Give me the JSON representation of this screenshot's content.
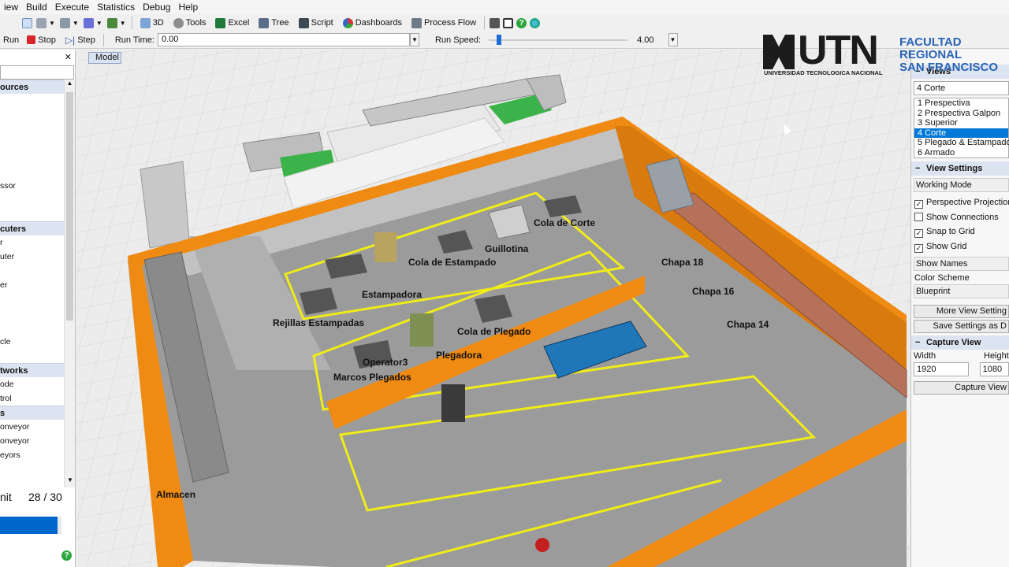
{
  "menu": [
    "iew",
    "Build",
    "Execute",
    "Statistics",
    "Debug",
    "Help"
  ],
  "toolbar": {
    "btn_3d": "3D",
    "btn_tools": "Tools",
    "btn_excel": "Excel",
    "btn_tree": "Tree",
    "btn_script": "Script",
    "btn_dashboards": "Dashboards",
    "btn_processflow": "Process Flow"
  },
  "runbar": {
    "run": "Run",
    "stop": "Stop",
    "step": "Step",
    "run_time_label": "Run Time:",
    "run_time_value": "0.00",
    "run_speed_label": "Run Speed:",
    "run_speed_value": "4.00",
    "run_speed_fraction": 0.08
  },
  "left_panel": {
    "close": "✕",
    "sections": [
      {
        "title": "ources",
        "items": [
          "",
          "",
          "",
          "",
          "",
          "",
          "ssor",
          "",
          ""
        ]
      },
      {
        "title": "cuters",
        "items": [
          "r",
          "uter",
          "",
          "er",
          "",
          "",
          "",
          "cle",
          ""
        ]
      },
      {
        "title": "tworks",
        "items": [
          "ode",
          "trol"
        ]
      },
      {
        "title": "s",
        "items": [
          "onveyor",
          "onveyor",
          "eyors"
        ]
      }
    ],
    "limit_label": "nit",
    "limit_value": "28 / 30",
    "limit_fraction": 0.93
  },
  "model_tab": "Model",
  "scene_labels": {
    "cola_corte": "Cola de Corte",
    "guillotina": "Guillotina",
    "cola_estampado": "Cola de Estampado",
    "estampadora": "Estampadora",
    "rejillas": "Rejillas Estampadas",
    "cola_plegado": "Cola de Plegado",
    "plegadora": "Plegadora",
    "operator3": "Operator3",
    "marcos": "Marcos Plegados",
    "chapa18": "Chapa 18",
    "chapa16": "Chapa 16",
    "chapa14": "Chapa 14",
    "almacen": "Almacen"
  },
  "logo": {
    "main": "UTN",
    "sub": "UNIVERSIDAD TECNOLOGICA NACIONAL",
    "faculty1": "FACULTAD",
    "faculty2": "REGIONAL",
    "faculty3": "SAN FRANCISCO"
  },
  "right_panel": {
    "views_title": "Views",
    "views_selected": "4 Corte",
    "views_list": [
      "1 Prespectiva",
      "2 Prespectiva Galpon",
      "3 Superior",
      "4 Corte",
      "5 Plegado & Estampado",
      "6 Armado"
    ],
    "view_settings_title": "View Settings",
    "working_mode": "Working Mode",
    "checks": [
      {
        "label": "Perspective Projection",
        "checked": true
      },
      {
        "label": "Show Connections",
        "checked": false
      },
      {
        "label": "Snap to Grid",
        "checked": true
      },
      {
        "label": "Show Grid",
        "checked": true
      }
    ],
    "show_names": "Show Names",
    "color_scheme_label": "Color Scheme",
    "color_scheme_value": "Blueprint",
    "more_settings": "More View Setting",
    "save_settings": "Save Settings as D",
    "capture_title": "Capture View",
    "width_label": "Width",
    "height_label": "Height",
    "width_value": "1920",
    "height_value": "1080",
    "capture_button": "Capture View"
  },
  "colors": {
    "wall": "#ef8a12",
    "floor": "#9a9a9a",
    "yellow_line": "#f0ec18",
    "selection": "#0078d7",
    "accent": "#0066cc"
  }
}
